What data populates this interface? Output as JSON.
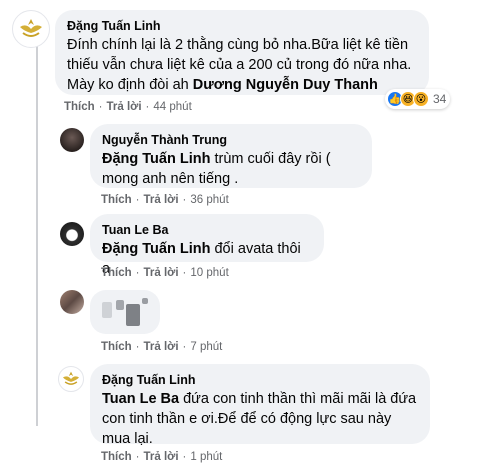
{
  "comments": [
    {
      "author": "Đặng Tuấn Linh",
      "text": "Đính chính lại là 2 thằng cùng bỏ nha.Bữa liệt kê tiền thiếu vẫn chưa liệt kê của a 200 củ trong đó nữa nha. Mày ko định đòi ah ",
      "mention": "Dương Nguyễn Duy Thanh",
      "like": "Thích",
      "reply": "Trả lời",
      "time": "44 phút",
      "reaction_count": "34",
      "reactions": [
        "like",
        "haha",
        "wow"
      ]
    },
    {
      "author": "Nguyễn Thành Trung",
      "mention": "Đặng Tuấn Linh",
      "text": " trùm cuối đây rồi ( mong anh nên tiếng .",
      "like": "Thích",
      "reply": "Trả lời",
      "time": "36 phút"
    },
    {
      "author": "Tuan Le Ba",
      "mention": "Đặng Tuấn Linh",
      "text": " đổi avata thôi a",
      "like": "Thích",
      "reply": "Trả lời",
      "time": "10 phút"
    },
    {
      "author": "",
      "text": "",
      "like": "Thích",
      "reply": "Trả lời",
      "time": "7 phút"
    },
    {
      "author": "Đặng Tuấn Linh",
      "mention": "Tuan Le Ba",
      "text": " đứa con tinh thần thì mãi mãi là đứa con tinh thần e ơi.Để để có động lực sau này mua lại.",
      "like": "Thích",
      "reply": "Trả lời",
      "time": "1 phút"
    }
  ],
  "colors": {
    "bubble": "#f0f2f5",
    "meta": "#65676b",
    "like_blue": "#1877f2",
    "emoji_yellow": "#f7b125"
  },
  "icons": [
    "logo-avatar-icon",
    "like-reaction-icon",
    "haha-reaction-icon",
    "wow-reaction-icon"
  ]
}
